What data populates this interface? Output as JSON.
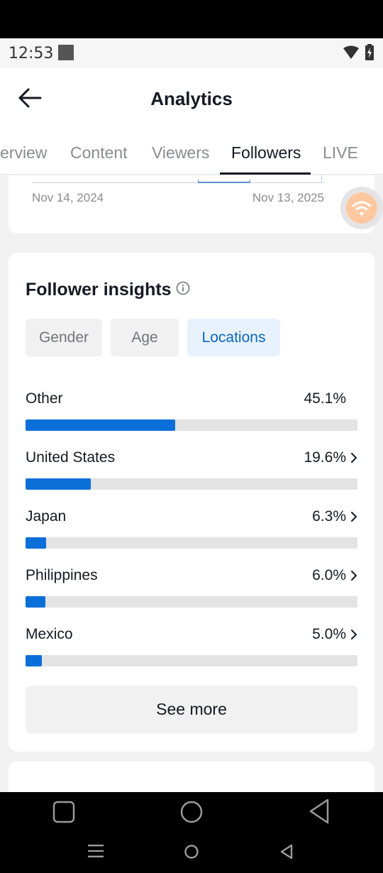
{
  "status": {
    "time": "12:53"
  },
  "header": {
    "title": "Analytics"
  },
  "tabs": [
    {
      "label": "erview"
    },
    {
      "label": "Content"
    },
    {
      "label": "Viewers"
    },
    {
      "label": "Followers",
      "active": true
    },
    {
      "label": "LIVE"
    }
  ],
  "chart_card": {
    "start_date": "Nov 14, 2024",
    "end_date": "Nov 13, 2025"
  },
  "insights": {
    "title": "Follower insights",
    "chips": [
      {
        "label": "Gender"
      },
      {
        "label": "Age"
      },
      {
        "label": "Locations",
        "active": true
      }
    ],
    "locations": [
      {
        "name": "Other",
        "percent": "45.1%",
        "value": 45.1,
        "chevron": false
      },
      {
        "name": "United States",
        "percent": "19.6%",
        "value": 19.6,
        "chevron": true
      },
      {
        "name": "Japan",
        "percent": "6.3%",
        "value": 6.3,
        "chevron": true
      },
      {
        "name": "Philippines",
        "percent": "6.0%",
        "value": 6.0,
        "chevron": true
      },
      {
        "name": "Mexico",
        "percent": "5.0%",
        "value": 5.0,
        "chevron": true
      }
    ],
    "see_more": "See more"
  },
  "next_card": {
    "title": ""
  },
  "colors": {
    "accent": "#0a6fd8",
    "accent_bg": "#e8f2fd",
    "track": "#e3e3e4"
  }
}
